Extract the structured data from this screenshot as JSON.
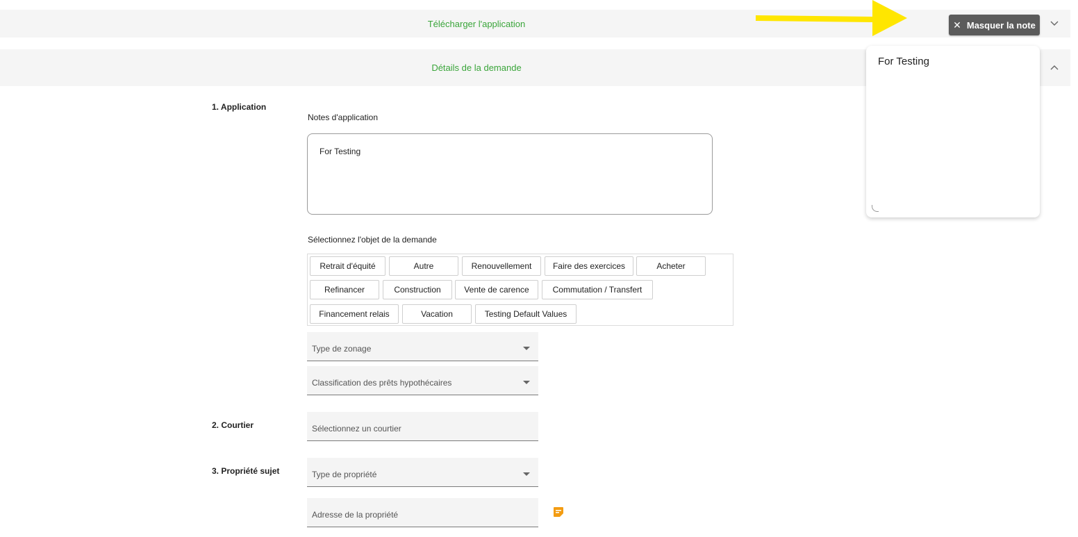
{
  "header": {
    "download_label": "Télécharger l'application",
    "details_label": "Détails de la demande",
    "hide_note_label": "Masquer la note"
  },
  "note_panel": {
    "text": "For Testing"
  },
  "sections": {
    "application": "1. Application",
    "broker": "2. Courtier",
    "property": "3. Propriété sujet"
  },
  "application": {
    "notes_label": "Notes d'application",
    "notes_value": "For Testing",
    "purpose_label": "Sélectionnez l'objet de la demande",
    "purposes": [
      "Retrait d'équité",
      "Autre",
      "Renouvellement",
      "Faire des exercices",
      "Acheter",
      "Refinancer",
      "Construction",
      "Vente de carence",
      "Commutation / Transfert",
      "Financement relais",
      "Vacation",
      "Testing Default Values"
    ],
    "zoning_placeholder": "Type de zonage",
    "mortgage_class_placeholder": "Classification des prêts hypothécaires"
  },
  "broker": {
    "select_placeholder": "Sélectionnez un courtier"
  },
  "property": {
    "type_placeholder": "Type de propriété",
    "address_placeholder": "Adresse de la propriété"
  },
  "colors": {
    "accent_green": "#3aa53a",
    "arrow_yellow": "#ffe600",
    "note_icon_orange": "#f39c12",
    "button_gray": "#5b5b5b"
  }
}
